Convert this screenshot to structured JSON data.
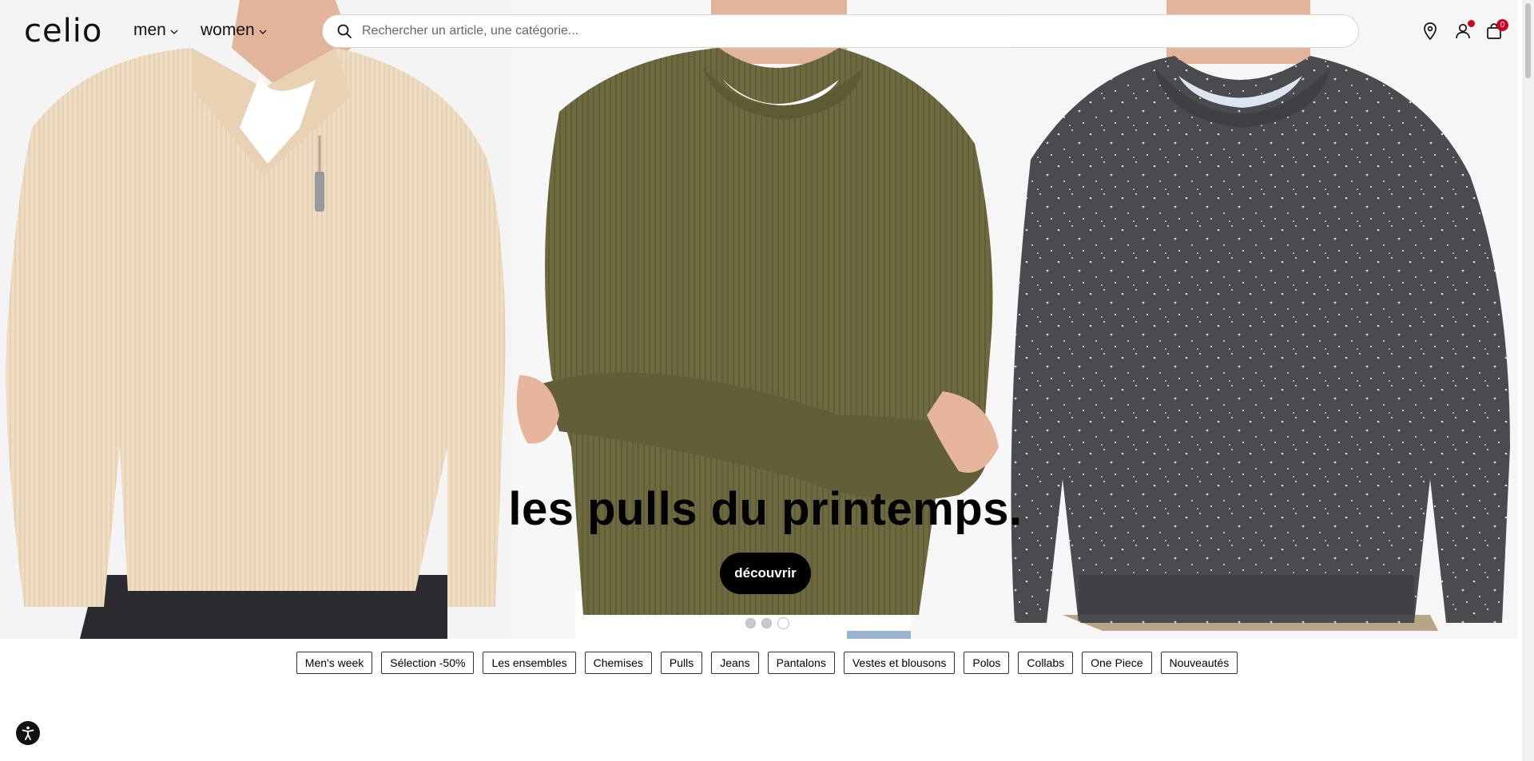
{
  "header": {
    "logo": "celio",
    "nav": [
      {
        "label": "men"
      },
      {
        "label": "women"
      }
    ],
    "search": {
      "placeholder": "Rechercher un article, une catégorie..."
    },
    "cart_count": "0",
    "icons": [
      "search-icon",
      "store-locator-icon",
      "account-icon",
      "cart-icon",
      "chevron-down-icon"
    ]
  },
  "hero": {
    "title": "les pulls du printemps.",
    "cta": "découvrir",
    "slides_count": 3,
    "active_slide": 3
  },
  "categories": [
    "Men's week",
    "Sélection -50%",
    "Les ensembles",
    "Chemises",
    "Pulls",
    "Jeans",
    "Pantalons",
    "Vestes et blousons",
    "Polos",
    "Collabs",
    "One Piece",
    "Nouveautés"
  ],
  "colors": {
    "accent": "#d0021b",
    "cta_bg": "#000000",
    "sweater_beige": "#efdcc0",
    "sweater_olive": "#6e6a3f",
    "sweater_grey": "#4a4b4e"
  }
}
